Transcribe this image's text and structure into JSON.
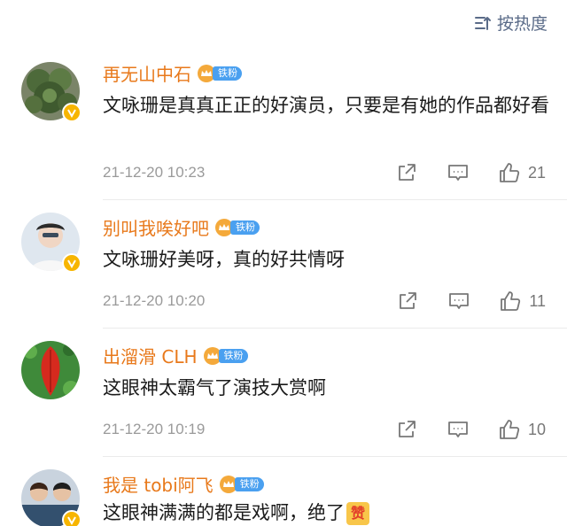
{
  "sort": {
    "label": "按热度",
    "icon": "sort-icon"
  },
  "comments": [
    {
      "username": "再无山中石",
      "fan_badge": "铁粉",
      "text": "文咏珊是真真正正的好演员，只要是有她的作品都好看",
      "time": "21-12-20 10:23",
      "likes": "21",
      "avatar": "succulent-plant-avatar"
    },
    {
      "username": "别叫我唉好吧",
      "fan_badge": "铁粉",
      "text": "文咏珊好美呀，真的好共情呀",
      "time": "21-12-20 10:20",
      "likes": "11",
      "avatar": "person-avatar"
    },
    {
      "username": "出溜滑 CLH",
      "fan_badge": "铁粉",
      "text": "这眼神太霸气了演技大赏啊",
      "time": "21-12-20 10:19",
      "likes": "10",
      "avatar": "red-leaf-avatar"
    },
    {
      "username": "我是 tobi阿飞",
      "fan_badge": "铁粉",
      "text": "这眼神满满的都是戏啊，绝了",
      "emoji": "赞",
      "avatar": "group-photo-avatar"
    }
  ],
  "colors": {
    "username": "#e8791b",
    "fan_badge": "#4aa0f0",
    "verified": "#f7b500",
    "sort": "#5a6b88"
  }
}
